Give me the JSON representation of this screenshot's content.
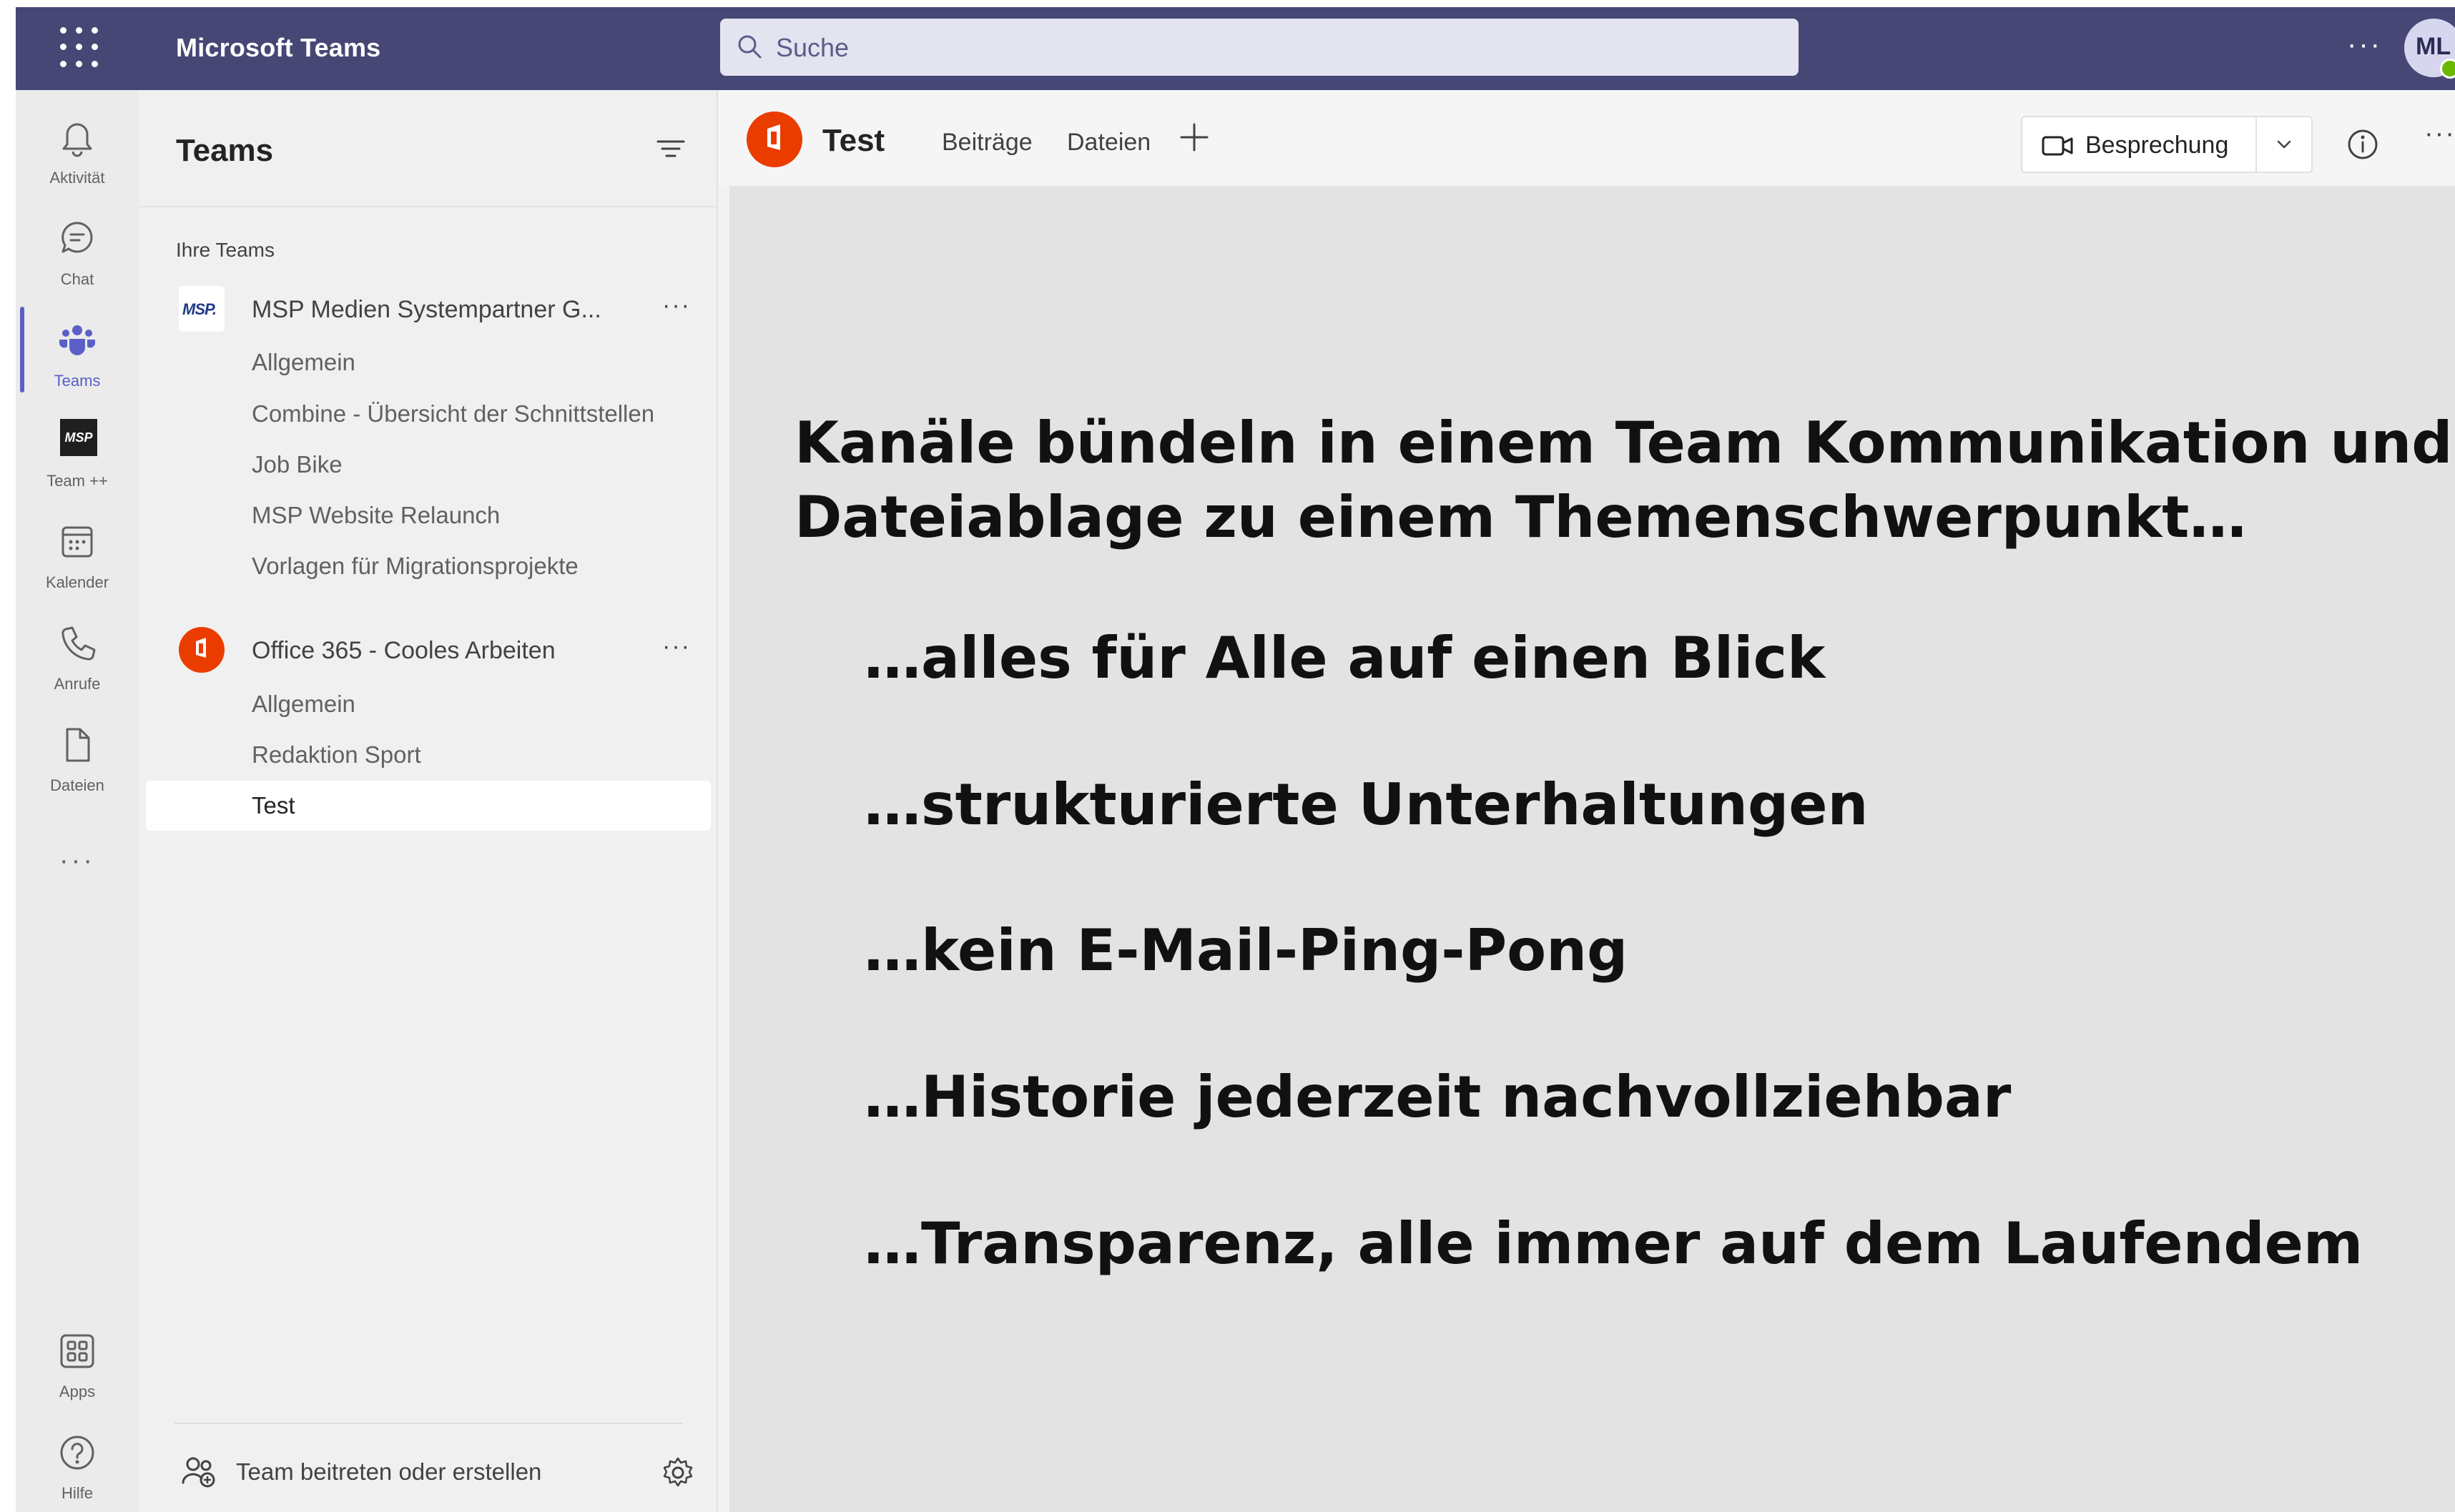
{
  "topbar": {
    "app_title": "Microsoft Teams",
    "search_placeholder": "Suche",
    "more": "···",
    "avatar_initials": "ML"
  },
  "rail": {
    "items": [
      {
        "label": "Aktivität",
        "icon": "bell-icon"
      },
      {
        "label": "Chat",
        "icon": "chat-icon"
      },
      {
        "label": "Teams",
        "icon": "teams-icon"
      },
      {
        "label": "Team ++",
        "icon": "msp-app-icon",
        "icon_text": "MSP"
      },
      {
        "label": "Kalender",
        "icon": "calendar-icon"
      },
      {
        "label": "Anrufe",
        "icon": "phone-icon"
      },
      {
        "label": "Dateien",
        "icon": "file-icon"
      },
      {
        "label": "Apps",
        "icon": "apps-icon"
      },
      {
        "label": "Hilfe",
        "icon": "help-icon"
      }
    ],
    "more": "···"
  },
  "pane": {
    "title": "Teams",
    "section": "Ihre Teams",
    "teams": [
      {
        "name": "MSP Medien Systempartner G...",
        "logo_text": "MSP.",
        "more": "···",
        "channels": [
          "Allgemein",
          "Combine - Übersicht der Schnittstellen",
          "Job Bike",
          "MSP Website Relaunch",
          "Vorlagen für Migrationsprojekte"
        ]
      },
      {
        "name": "Office 365 - Cooles Arbeiten",
        "more": "···",
        "channels": [
          "Allgemein",
          "Redaktion Sport",
          "Test"
        ]
      }
    ],
    "footer": "Team beitreten oder erstellen"
  },
  "channel_header": {
    "title": "Test",
    "tabs": [
      "Beiträge",
      "Dateien"
    ],
    "meeting_button": "Besprechung",
    "more": "···"
  },
  "content": {
    "headline": "Kanäle bündeln in einem Team Kommunikation und Dateiablage zu einem Themenschwerpunkt…",
    "bullets": [
      "…alles für Alle auf einen Blick",
      "…strukturierte Unterhaltungen",
      "…kein E-Mail-Ping-Pong",
      "…Historie jederzeit nachvollziehbar",
      "…Transparenz, alle immer auf dem Laufendem"
    ]
  },
  "colors": {
    "topbar": "#464775",
    "accent": "#5b5fc7",
    "office_red": "#eb3c00"
  }
}
